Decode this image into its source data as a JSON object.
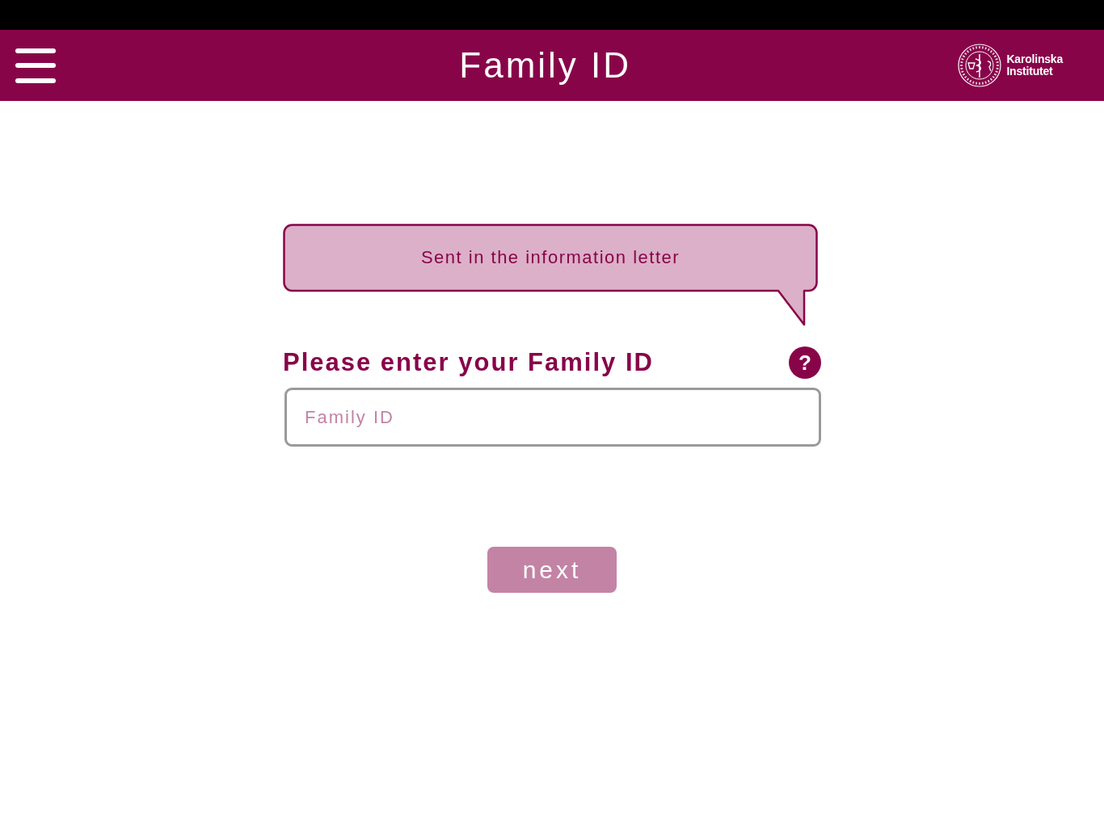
{
  "header": {
    "title": "Family ID",
    "logo": {
      "wordmark": [
        "Karolinska",
        "Institutet"
      ]
    }
  },
  "hint_bubble": {
    "text": "Sent in the information letter"
  },
  "form": {
    "label": "Please enter your Family ID",
    "help_button": "?",
    "field": {
      "placeholder": "Family ID"
    }
  },
  "next_button": {
    "label": "next",
    "disabled": true
  }
}
